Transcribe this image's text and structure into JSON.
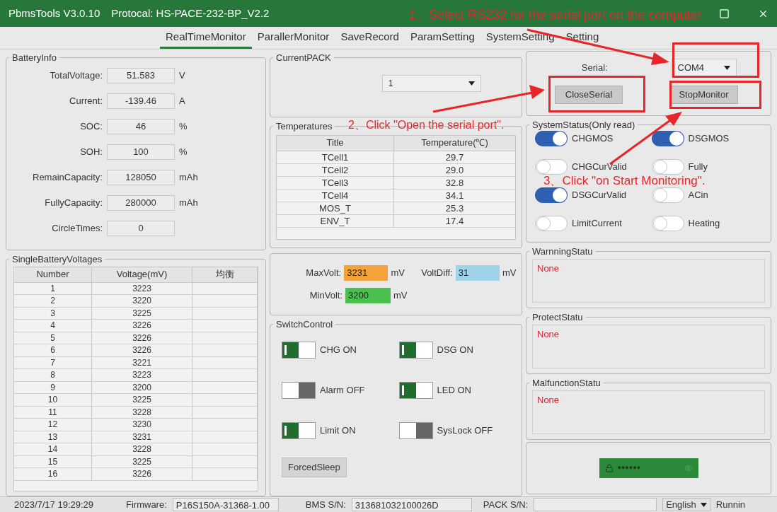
{
  "window": {
    "title": "PbmsTools V3.0.10",
    "protocol": "Protocal: HS-PACE-232-BP_V2.2"
  },
  "tabs": [
    {
      "label": "RealTimeMonitor",
      "selected": true
    },
    {
      "label": "ParallerMonitor",
      "selected": false
    },
    {
      "label": "SaveRecord",
      "selected": false
    },
    {
      "label": "ParamSetting",
      "selected": false
    },
    {
      "label": "SystemSetting",
      "selected": false
    },
    {
      "label": "Setting",
      "selected": false
    }
  ],
  "battery_info": {
    "title": "BatteryInfo",
    "fields": [
      {
        "label": "TotalVoltage:",
        "value": "51.583",
        "unit": "V"
      },
      {
        "label": "Current:",
        "value": "-139.46",
        "unit": "A"
      },
      {
        "label": "SOC:",
        "value": "46",
        "unit": "%"
      },
      {
        "label": "SOH:",
        "value": "100",
        "unit": "%"
      },
      {
        "label": "RemainCapacity:",
        "value": "128050",
        "unit": "mAh"
      },
      {
        "label": "FullyCapacity:",
        "value": "280000",
        "unit": "mAh"
      },
      {
        "label": "CircleTimes:",
        "value": "0"
      }
    ]
  },
  "current_pack": {
    "title": "CurrentPACK",
    "value": "1"
  },
  "temperatures": {
    "title": "Temperatures",
    "columns": [
      "Title",
      "Temperature(℃)"
    ],
    "rows": [
      [
        "TCell1",
        "29.7"
      ],
      [
        "TCell2",
        "29.0"
      ],
      [
        "TCell3",
        "32.8"
      ],
      [
        "TCell4",
        "34.1"
      ],
      [
        "MOS_T",
        "25.3"
      ],
      [
        "ENV_T",
        "17.4"
      ]
    ]
  },
  "serial": {
    "label": "Serial:",
    "port": "COM4",
    "buttons": [
      "CloseSerial",
      "StopMonitor"
    ]
  },
  "system_status": {
    "title": "SystemStatus(Only read)",
    "switches": [
      {
        "label": "CHGMOS",
        "on": true
      },
      {
        "label": "DSGMOS",
        "on": true
      },
      {
        "label": "CHGCurValid",
        "on": false
      },
      {
        "label": "Fully",
        "on": false
      },
      {
        "label": "DSGCurValid",
        "on": true
      },
      {
        "label": "ACin",
        "on": false
      },
      {
        "label": "LimitCurrent",
        "on": false
      },
      {
        "label": "Heating",
        "on": false
      }
    ]
  },
  "cell_voltages": {
    "title": "SingleBatteryVoltages",
    "columns": [
      "Number",
      "Voltage(mV)",
      "均衡"
    ],
    "rows": [
      [
        "1",
        "3223"
      ],
      [
        "2",
        "3220"
      ],
      [
        "3",
        "3225"
      ],
      [
        "4",
        "3226"
      ],
      [
        "5",
        "3226"
      ],
      [
        "6",
        "3226"
      ],
      [
        "7",
        "3221"
      ],
      [
        "8",
        "3223"
      ],
      [
        "9",
        "3200"
      ],
      [
        "10",
        "3225"
      ],
      [
        "11",
        "3228"
      ],
      [
        "12",
        "3230"
      ],
      [
        "13",
        "3231"
      ],
      [
        "14",
        "3228"
      ],
      [
        "15",
        "3225"
      ],
      [
        "16",
        "3226"
      ]
    ]
  },
  "volts": [
    {
      "label": "MaxVolt:",
      "value": "3231",
      "unit": "mV",
      "color": "#f4a33c"
    },
    {
      "label": "VoltDiff:",
      "value": "31",
      "unit": "mV",
      "color": "#9fd3ea"
    },
    {
      "label": "MinVolt:",
      "value": "3200",
      "unit": "mV",
      "color": "#4cc04f"
    }
  ],
  "switch_control": {
    "title": "SwitchControl",
    "switches": [
      {
        "label": "CHG ON",
        "on": true
      },
      {
        "label": "DSG ON",
        "on": true
      },
      {
        "label": "Alarm OFF",
        "on": false
      },
      {
        "label": "LED ON",
        "on": true
      },
      {
        "label": "Limit ON",
        "on": true
      },
      {
        "label": "SysLock OFF",
        "on": false
      }
    ],
    "button": "ForcedSleep"
  },
  "status_panels": [
    {
      "title": "WarnningStatu",
      "text": "None"
    },
    {
      "title": "ProtectStatu",
      "text": "None"
    },
    {
      "title": "MalfunctionStatu",
      "text": "None"
    }
  ],
  "password": {
    "value": "●●●●●●"
  },
  "status_bar": {
    "datetime": "2023/7/17 19:29:29",
    "firmware_label": "Firmware:",
    "firmware": "P16S150A-31368-1.00",
    "bms_sn_label": "BMS S/N:",
    "bms_sn": "313681032100026D",
    "pack_sn_label": "PACK S/N:",
    "language": "English",
    "state": "Runnin"
  },
  "annotations": [
    "1、Select RS232 for the serial port on the computer",
    "2、Click \"Open the serial port\".",
    "3、Click \"on Start Monitoring\"."
  ]
}
